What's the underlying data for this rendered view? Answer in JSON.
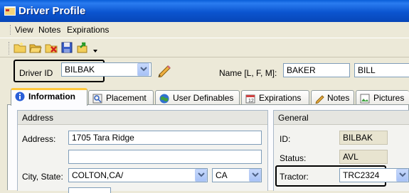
{
  "window": {
    "title": "Driver Profile"
  },
  "menu": {
    "items": [
      "View",
      "Notes",
      "Expirations"
    ]
  },
  "toolbar": {
    "buttons": [
      "new-folder-icon",
      "open-folder-icon",
      "delete-icon",
      "save-icon",
      "export-icon",
      "overflow-chevron-icon"
    ]
  },
  "driver": {
    "id_label": "Driver ID",
    "id_value": "BILBAK",
    "name_label": "Name [L, F, M]:",
    "last_name": "BAKER",
    "first_name": "BILL",
    "middle_name": ""
  },
  "tabs": [
    {
      "label": "Information",
      "icon": "info-icon",
      "active": true
    },
    {
      "label": "Placement",
      "icon": "placement-icon",
      "active": false
    },
    {
      "label": "User Definables",
      "icon": "globe-icon",
      "active": false
    },
    {
      "label": "Expirations",
      "icon": "calendar-icon",
      "active": false
    },
    {
      "label": "Notes",
      "icon": "pencil-icon",
      "active": false
    },
    {
      "label": "Pictures",
      "icon": "pictures-icon",
      "active": false
    }
  ],
  "address": {
    "header": "Address",
    "address_label": "Address:",
    "address1": "1705 Tara Ridge",
    "address2": "",
    "city_label": "City, State:",
    "city_value": "COLTON,CA/",
    "state_value": "CA"
  },
  "general": {
    "header": "General",
    "id_label": "ID:",
    "id_value": "BILBAK",
    "status_label": "Status:",
    "status_value": "AVL",
    "tractor_label": "Tractor:",
    "tractor_value": "TRC2324"
  },
  "colors": {
    "title_bar": "#0a5fd8",
    "active_tab_accent": "#ffc83c",
    "field_border": "#7f9db9"
  }
}
